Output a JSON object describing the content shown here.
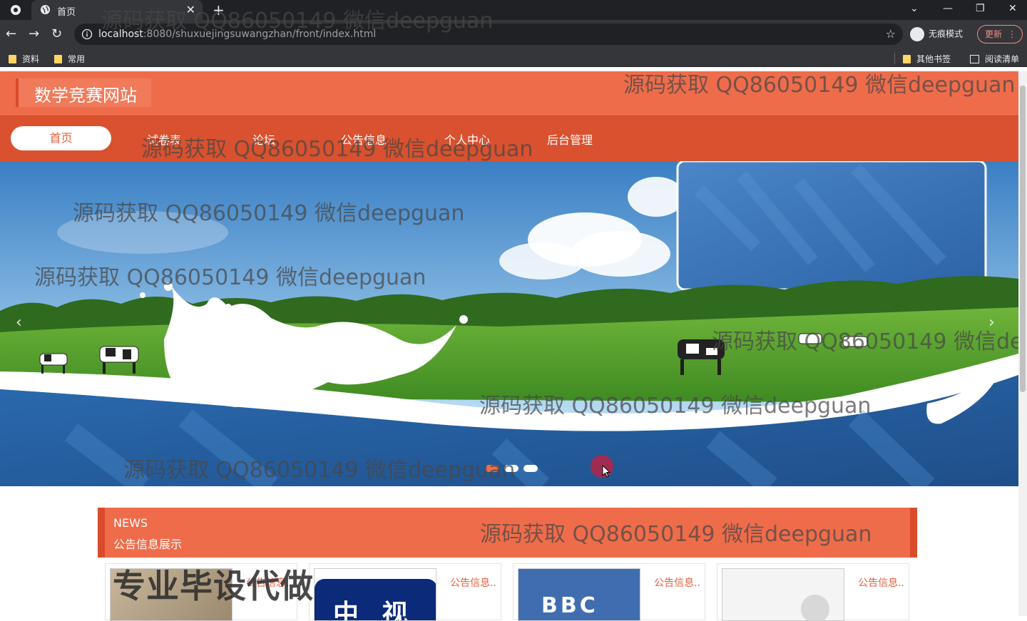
{
  "browser": {
    "tab_title": "首页",
    "url_host": "localhost",
    "url_path": ":8080/shuxuejingsuwangzhan/front/index.html",
    "incognito_label": "无痕模式",
    "update_label": "更新",
    "bookmarks": [
      "资料",
      "常用"
    ],
    "other_bookmarks": "其他书签",
    "reading_list": "阅读清单"
  },
  "site": {
    "title": "数学竞赛网站",
    "nav": [
      "首页",
      "试卷表",
      "论坛",
      "公告信息",
      "个人中心",
      "后台管理"
    ]
  },
  "banner": {
    "slide_count": 3,
    "active_slide": 1,
    "colors": {
      "sky": "#3f86c9",
      "grass": "#4f9a2c",
      "milk": "#ffffff",
      "base": "#2d6bb0"
    }
  },
  "news": {
    "label_en": "NEWS",
    "label_cn": "公告信息展示",
    "cards": [
      {
        "title": "公告信息..",
        "thumb": "photo"
      },
      {
        "title": "公告信息..",
        "thumb_text": "中 视"
      },
      {
        "title": "公告信息..",
        "thumb_text": "BBC"
      },
      {
        "title": "公告信息..",
        "thumb": "blank"
      }
    ]
  },
  "overlay_text": "专业毕设代做",
  "watermark": "源码获取 QQ86050149 微信deepguan",
  "colors": {
    "accent": "#ef6c4a",
    "nav_bg": "#d9512e",
    "accent_dark": "#d94b2a"
  }
}
